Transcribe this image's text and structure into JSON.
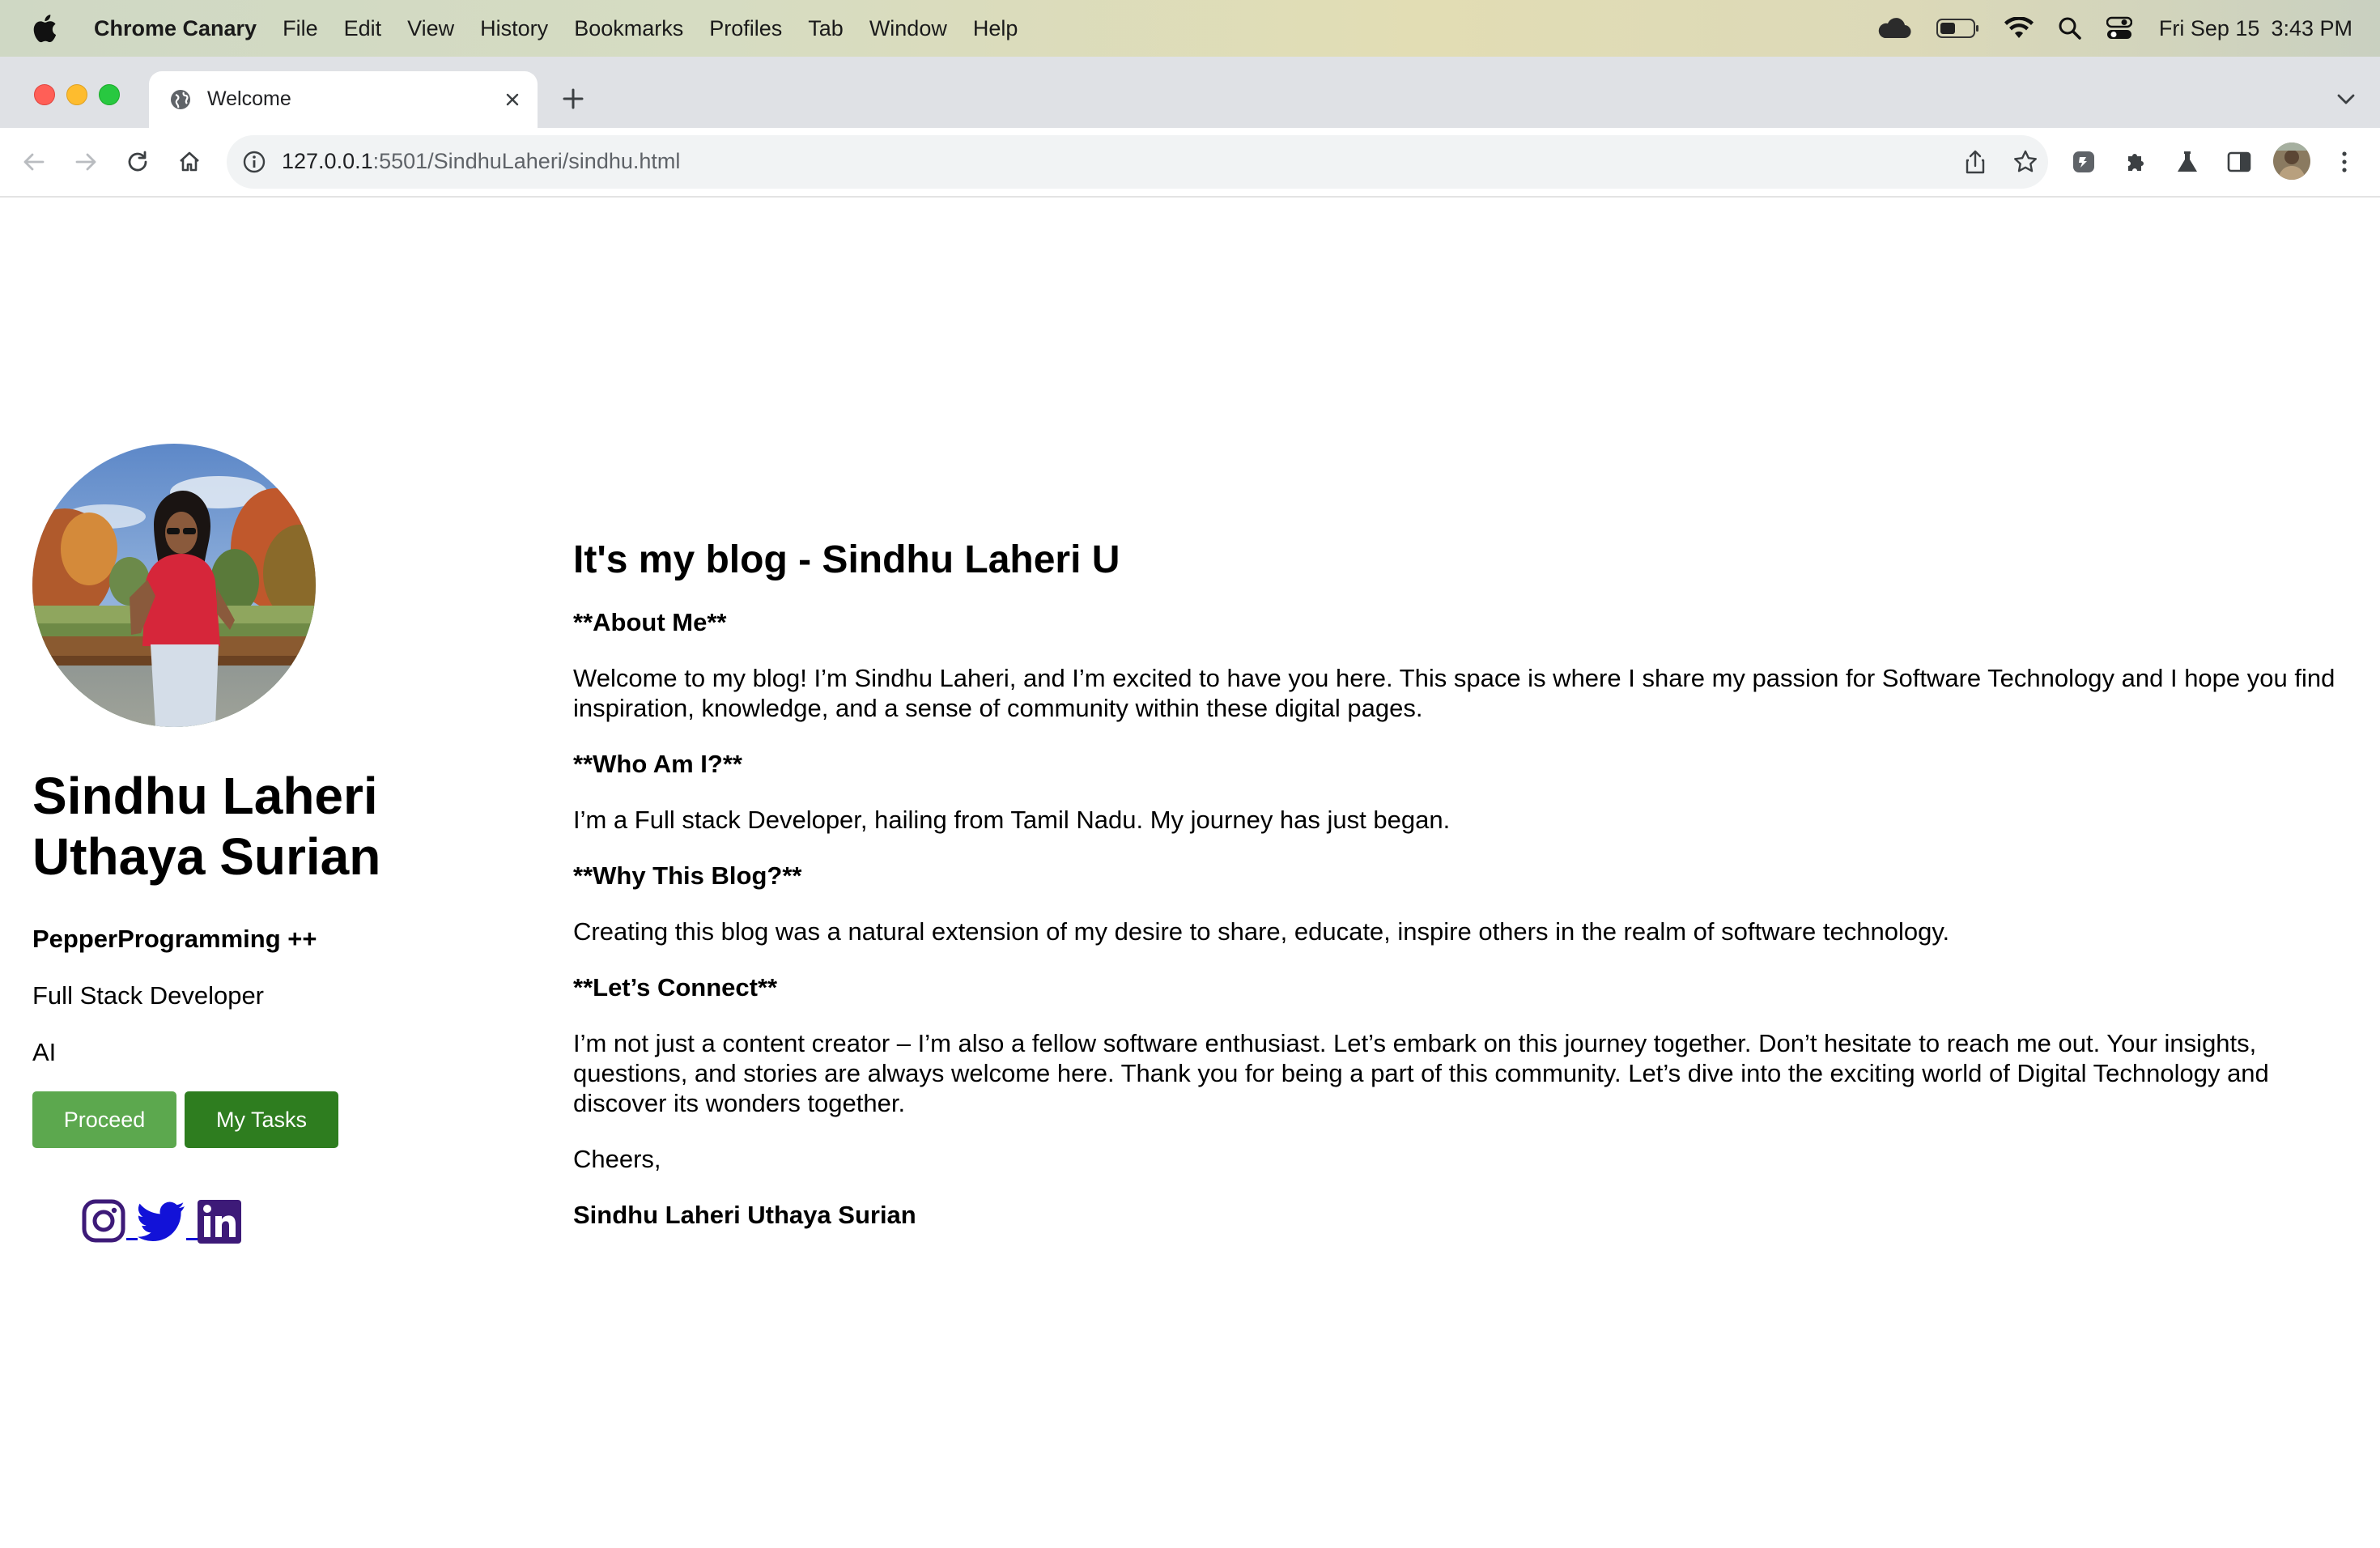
{
  "menubar": {
    "app_name": "Chrome Canary",
    "items": [
      "File",
      "Edit",
      "View",
      "History",
      "Bookmarks",
      "Profiles",
      "Tab",
      "Window",
      "Help"
    ],
    "clock_date": "Fri Sep 15",
    "clock_time": "3:43 PM",
    "status_icons": [
      "cloud-icon",
      "battery-icon",
      "wifi-icon",
      "spotlight-search-icon",
      "control-center-icon"
    ]
  },
  "browser": {
    "tab_title": "Welcome",
    "url_host": "127.0.0.1",
    "url_path": ":5501/SindhuLaheri/sindhu.html",
    "accent": "#1a73e8"
  },
  "profile": {
    "name": "Sindhu Laheri Uthaya Surian",
    "brand": "PepperProgramming ++",
    "role": "Full Stack Developer",
    "interest": "AI",
    "buttons": {
      "proceed": "Proceed",
      "tasks": "My Tasks"
    },
    "button_colors": {
      "proceed": "#5ca84e",
      "tasks": "#2e7d1f"
    },
    "social_icons": [
      "instagram-icon",
      "twitter-icon",
      "linkedin-icon"
    ],
    "social_colors": {
      "instagram": "#3d1a78",
      "twitter": "#1212d8",
      "linkedin": "#3d1a78"
    }
  },
  "blog": {
    "title": "It's my blog - Sindhu Laheri U",
    "about_heading": "**About Me**",
    "about_text": "Welcome to my blog! I’m Sindhu Laheri, and I’m excited to have you here. This space is where I share my passion for Software Technology and I hope you find inspiration, knowledge, and a sense of community within these digital pages.",
    "who_heading": "**Who Am I?**",
    "who_text": "I’m a Full stack Developer, hailing from Tamil Nadu. My journey has just began.",
    "why_heading": "**Why This Blog?**",
    "why_text": "Creating this blog was a natural extension of my desire to share, educate, inspire others in the realm of software technology.",
    "connect_heading": "**Let’s Connect**",
    "connect_text": "I’m not just a content creator – I’m also a fellow software enthusiast. Let’s embark on this journey together. Don’t hesitate to reach me out. Your insights, questions, and stories are always welcome here. Thank you for being a part of this community. Let’s dive into the exciting world of Digital Technology and discover its wonders together.",
    "closing": "Cheers,",
    "signature": "Sindhu Laheri Uthaya Surian"
  }
}
